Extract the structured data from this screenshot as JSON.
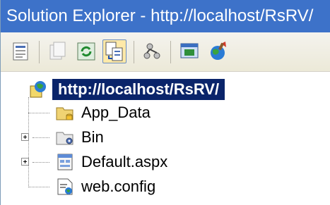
{
  "window": {
    "title": "Solution Explorer - http://localhost/RsRV/"
  },
  "toolbar": {
    "buttons": [
      {
        "icon": "properties-icon"
      },
      {
        "icon": "show-all-files-icon"
      },
      {
        "icon": "refresh-icon"
      },
      {
        "icon": "nest-related-files-icon"
      },
      {
        "icon": "copy-web-site-icon"
      },
      {
        "icon": "view-designer-icon"
      },
      {
        "icon": "asp-net-configuration-icon"
      }
    ]
  },
  "tree": {
    "root": {
      "label": "http://localhost/RsRV/",
      "icon": "web-project-icon"
    },
    "items": [
      {
        "label": "App_Data",
        "icon": "database-folder-icon",
        "expandable": false
      },
      {
        "label": "Bin",
        "icon": "bin-folder-icon",
        "expandable": true
      },
      {
        "label": "Default.aspx",
        "icon": "aspx-file-icon",
        "expandable": true
      },
      {
        "label": "web.config",
        "icon": "config-file-icon",
        "expandable": false
      }
    ]
  },
  "colors": {
    "title_bar": "#3d72c9",
    "selection": "#0a246a",
    "toolbar": "#ece9d8"
  }
}
